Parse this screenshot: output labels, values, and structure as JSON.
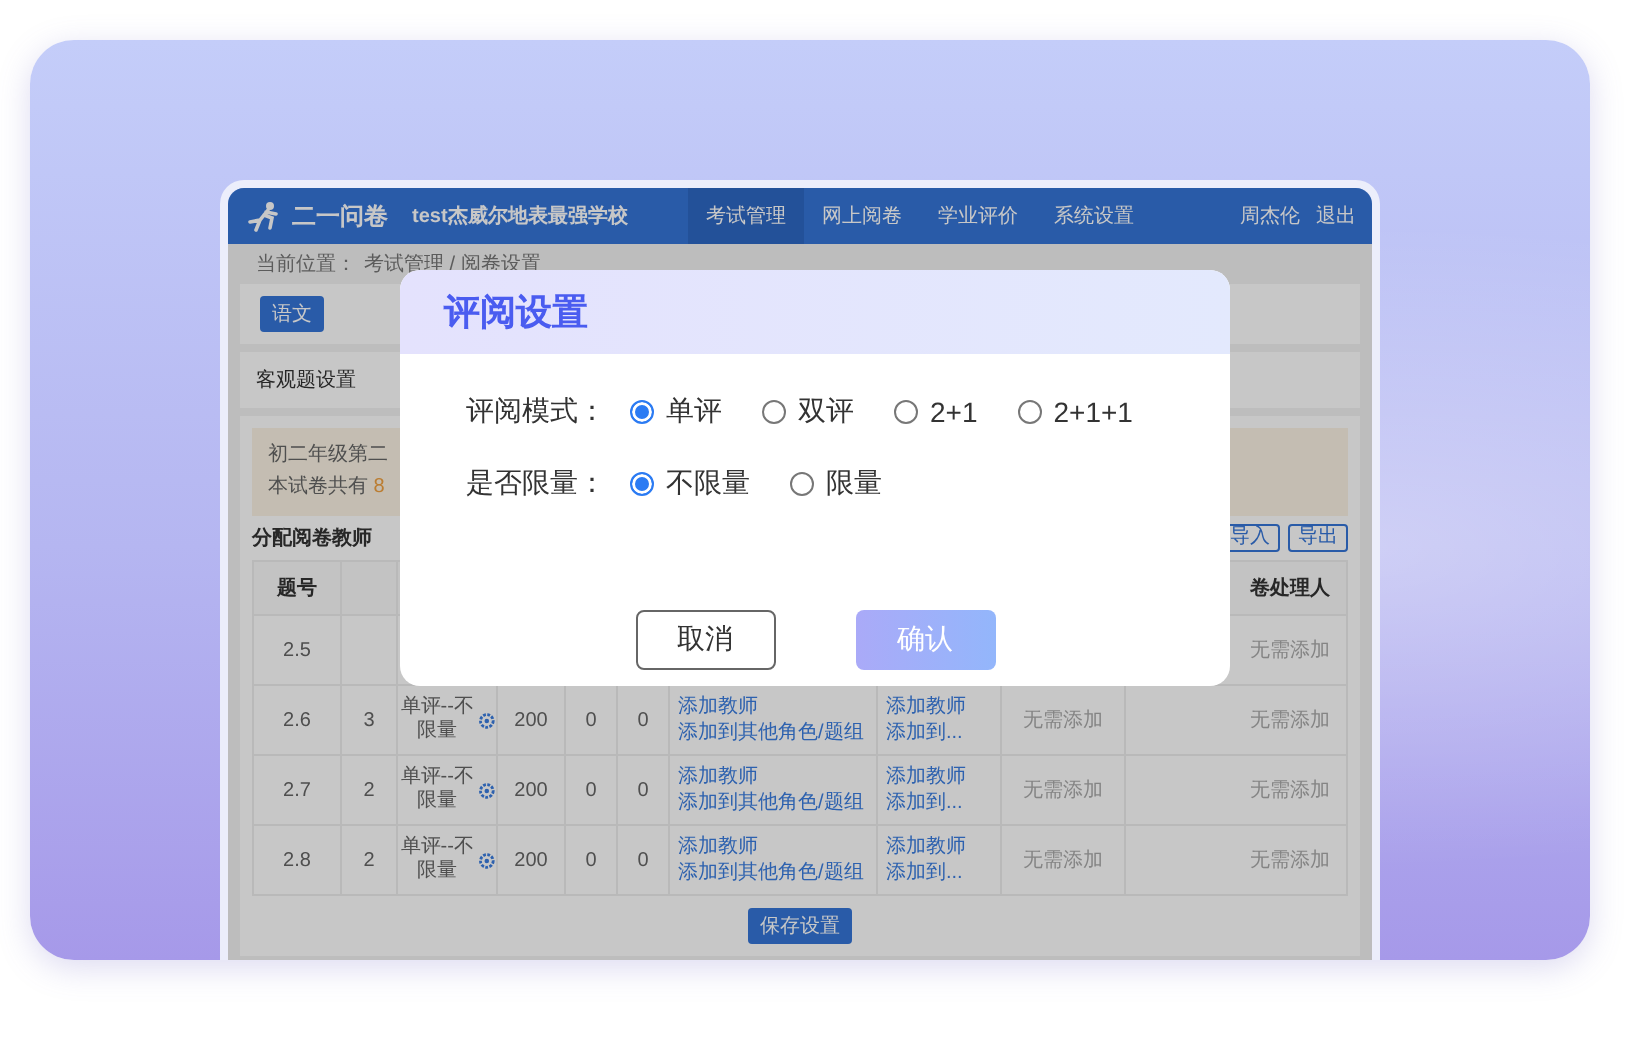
{
  "header": {
    "logo": "二一问卷",
    "school": "test杰威尔地表最强学校",
    "nav": [
      {
        "label": "考试管理",
        "selected": true
      },
      {
        "label": "网上阅卷",
        "selected": false
      },
      {
        "label": "学业评价",
        "selected": false
      },
      {
        "label": "系统设置",
        "selected": false
      }
    ],
    "user": "周杰伦",
    "logout": "退出"
  },
  "breadcrumb": {
    "label": "当前位置：",
    "path": "考试管理 / 阅卷设置"
  },
  "subject_tabs": [
    {
      "label": "语文",
      "selected": true
    }
  ],
  "objective_settings": {
    "label": "客观题设置"
  },
  "notice": {
    "line_1": "初二年级第二",
    "line_2_text": "本试卷共有",
    "line_2_count": "8"
  },
  "assign": {
    "title": "分配阅卷教师",
    "buttons": [
      "导入",
      "导出"
    ]
  },
  "table": {
    "header": {
      "column_1": "题号",
      "column_10": "卷处理人"
    },
    "rows": [
      {
        "number": "2.5",
        "column_10": "无需添加"
      },
      {
        "number": "2.6",
        "count": "3",
        "mode": "单评--不限量",
        "total": "200",
        "column_5": "0",
        "column_6": "0",
        "links_1": [
          "添加教师",
          "添加到其他角色/题组"
        ],
        "links_2": [
          "添加教师",
          "添加到..."
        ],
        "column_9": "无需添加",
        "column_10": "无需添加"
      },
      {
        "number": "2.7",
        "count": "2",
        "mode": "单评--不限量",
        "total": "200",
        "column_5": "0",
        "column_6": "0",
        "links_1": [
          "添加教师",
          "添加到其他角色/题组"
        ],
        "links_2": [
          "添加教师",
          "添加到..."
        ],
        "column_9": "无需添加",
        "column_10": "无需添加"
      },
      {
        "number": "2.8",
        "count": "2",
        "mode": "单评--不限量",
        "total": "200",
        "column_5": "0",
        "column_6": "0",
        "links_1": [
          "添加教师",
          "添加到其他角色/题组"
        ],
        "links_2": [
          "添加教师",
          "添加到..."
        ],
        "column_9": "无需添加",
        "column_10": "无需添加"
      }
    ]
  },
  "save_button": "保存设置",
  "dialog": {
    "title": "评阅设置",
    "fields": [
      {
        "label": "评阅模式：",
        "options": [
          {
            "label": "单评",
            "selected": true
          },
          {
            "label": "双评",
            "selected": false
          },
          {
            "label": "2+1",
            "selected": false
          },
          {
            "label": "2+1+1",
            "selected": false
          }
        ]
      },
      {
        "label": "是否限量：",
        "options": [
          {
            "label": "不限量",
            "selected": true
          },
          {
            "label": "限量",
            "selected": false
          }
        ]
      }
    ],
    "buttons": [
      {
        "label": "取消",
        "kind": "secondary"
      },
      {
        "label": "确认",
        "kind": "primary"
      }
    ]
  }
}
